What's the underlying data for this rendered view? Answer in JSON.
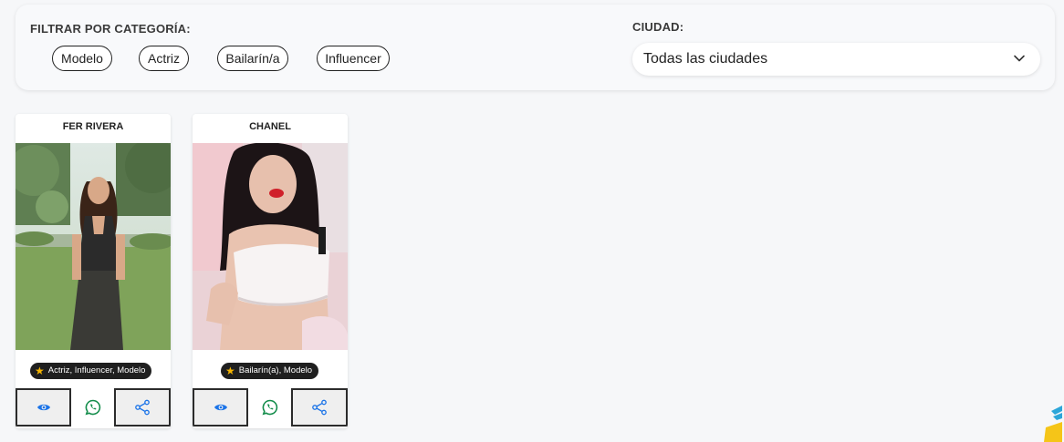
{
  "filters": {
    "category_title": "FILTRAR POR CATEGORÍA:",
    "categories": [
      "Modelo",
      "Actriz",
      "Bailarín/a",
      "Influencer"
    ],
    "city_title": "CIUDAD:",
    "city_selected": "Todas las ciudades"
  },
  "cards": [
    {
      "name": "FER RIVERA",
      "categories": "Actriz, Influencer, Modelo"
    },
    {
      "name": "CHANEL",
      "categories": "Bailarín(a), Modelo"
    }
  ],
  "icons": {
    "view": "eye-icon",
    "whatsapp": "whatsapp-icon",
    "share": "share-icon",
    "star": "star-icon",
    "chevron": "chevron-down-icon"
  },
  "colors": {
    "accent_blue": "#1a73e8",
    "whatsapp_green": "#128c4a",
    "badge_bg": "#1f1f1f",
    "star": "#f5b400"
  }
}
